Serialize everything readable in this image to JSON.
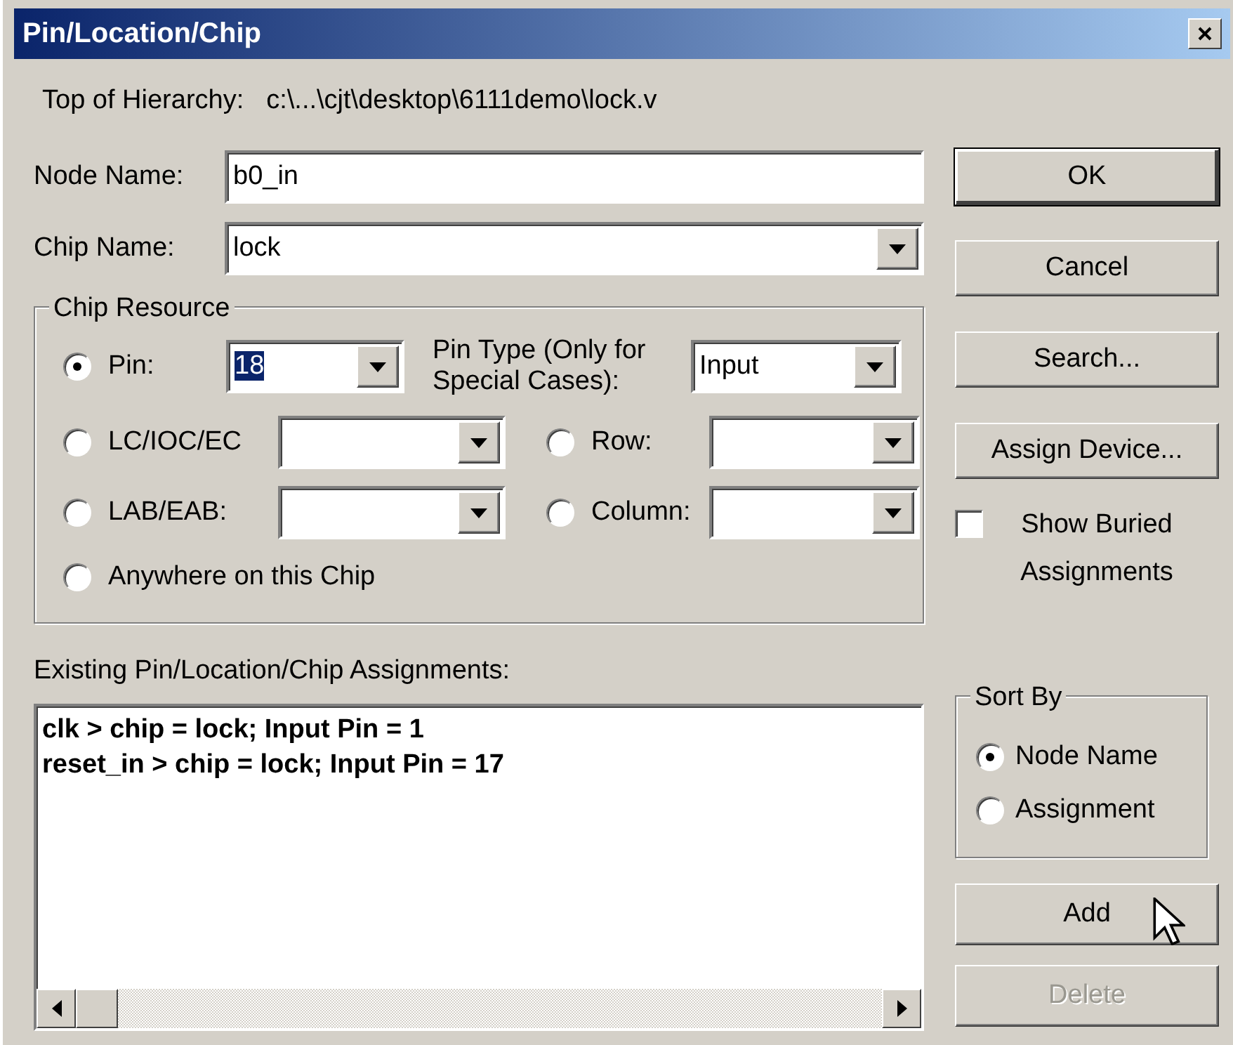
{
  "window": {
    "title": "Pin/Location/Chip"
  },
  "hierarchy": {
    "label": "Top of Hierarchy:",
    "value": "c:\\...\\cjt\\desktop\\6111demo\\lock.v"
  },
  "node_name": {
    "label": "Node Name:",
    "value": "b0_in"
  },
  "chip_name": {
    "label": "Chip Name:",
    "value": "lock"
  },
  "chip_resource": {
    "title": "Chip Resource",
    "options": [
      {
        "label": "Pin:",
        "selected": true,
        "kind": "combo",
        "value": "18",
        "value_highlighted": true
      },
      {
        "label": "LC/IOC/EC",
        "selected": false,
        "kind": "combo"
      },
      {
        "label": "Row:",
        "selected": false,
        "kind": "combo"
      },
      {
        "label": "LAB/EAB:",
        "selected": false,
        "kind": "combo"
      },
      {
        "label": "Column:",
        "selected": false,
        "kind": "combo"
      },
      {
        "label": "Anywhere on this Chip",
        "selected": false,
        "kind": "plain"
      }
    ],
    "pin_type": {
      "label": "Pin Type (Only for Special Cases):",
      "value": "Input"
    }
  },
  "assignments": {
    "label": "Existing Pin/Location/Chip Assignments:",
    "lines": [
      "clk > chip = lock; Input Pin = 1",
      "reset_in > chip = lock; Input Pin = 17"
    ]
  },
  "buttons": [
    {
      "label": "OK",
      "default": true
    },
    {
      "label": "Cancel",
      "default": false
    },
    {
      "label": "Search...",
      "default": false
    },
    {
      "label": "Assign Device...",
      "default": false
    }
  ],
  "show_buried": {
    "label": "Show Buried Assignments",
    "checked": false
  },
  "sort_by": {
    "title": "Sort By",
    "options": [
      {
        "label": "Node Name",
        "selected": true
      },
      {
        "label": "Assignment",
        "selected": false
      }
    ]
  },
  "action_buttons": [
    {
      "label": "Add",
      "disabled": false
    },
    {
      "label": "Delete",
      "disabled": true
    }
  ]
}
